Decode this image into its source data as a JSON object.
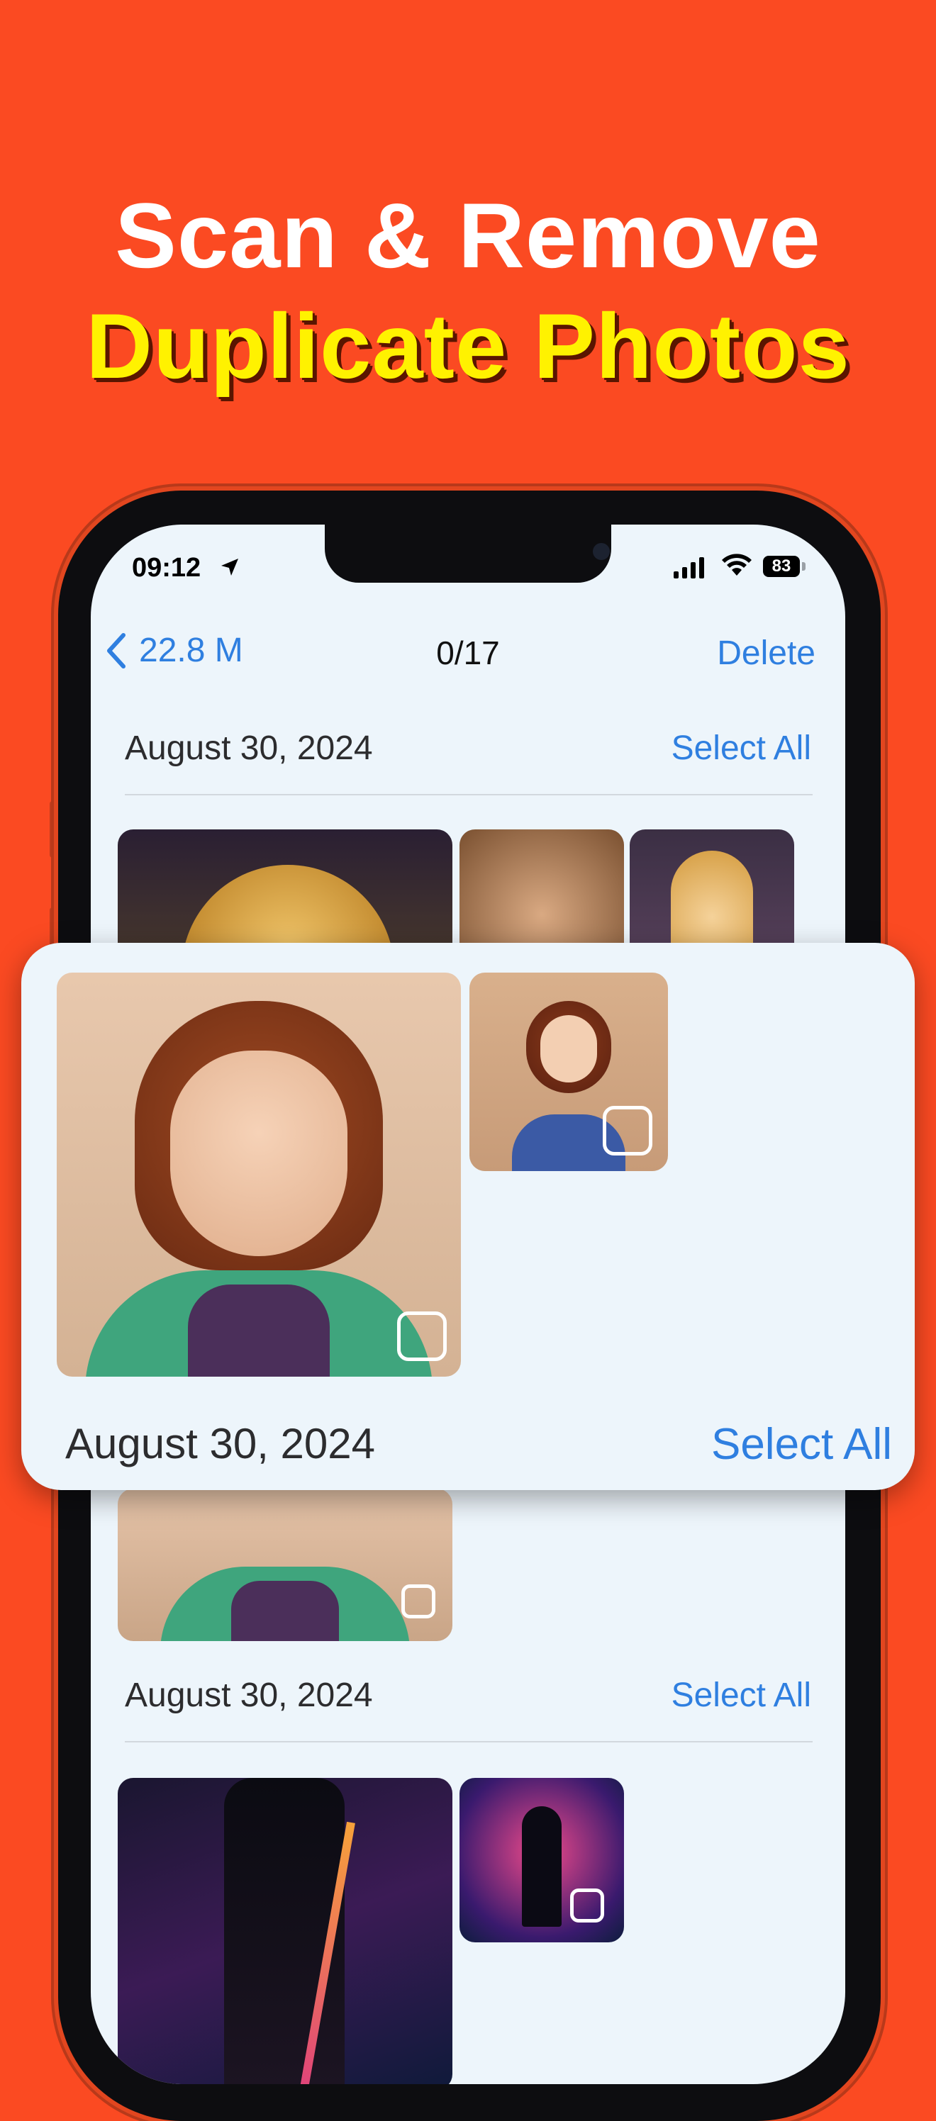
{
  "headline": {
    "line1": "Scan & Remove",
    "line2": "Duplicate Photos"
  },
  "status_bar": {
    "time": "09:12",
    "battery": "83"
  },
  "nav": {
    "back_label": "22.8 M",
    "count": "0/17",
    "delete_label": "Delete"
  },
  "groups": [
    {
      "date": "August 30, 2024",
      "select_all": "Select All"
    },
    {
      "date": "August 30, 2024",
      "select_all": "Select All"
    }
  ],
  "highlight_card": {
    "date": "August 30, 2024",
    "select_all": "Select All"
  },
  "colors": {
    "background": "#fb4a22",
    "accent": "#2f7fe0",
    "headline_yellow": "#fff200"
  }
}
